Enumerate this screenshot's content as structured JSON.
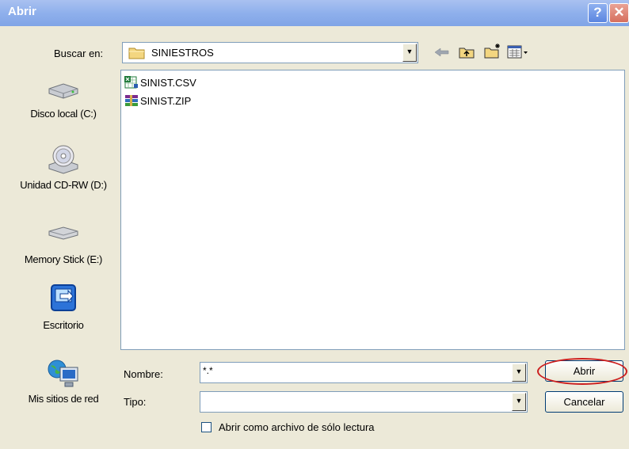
{
  "window": {
    "title": "Abrir"
  },
  "title_buttons": {
    "help": "?",
    "close": "✕"
  },
  "look_in": {
    "label": "Buscar en:",
    "value": "SINIESTROS",
    "icon": "folder-icon"
  },
  "toolbar": {
    "back_icon": "back-arrow-icon",
    "up_icon": "up-folder-icon",
    "new_folder_icon": "new-folder-icon",
    "view_icon": "view-menu-icon"
  },
  "places": [
    {
      "label": "Disco local (C:)",
      "icon": "hard-drive-icon"
    },
    {
      "label": "Unidad CD-RW (D:)",
      "icon": "cd-drive-icon"
    },
    {
      "label": "Memory Stick (E:)",
      "icon": "removable-drive-icon"
    },
    {
      "label": "Escritorio",
      "icon": "desktop-icon"
    },
    {
      "label": "Mis sitios de red",
      "icon": "network-places-icon"
    }
  ],
  "files": [
    {
      "name": "SINIST.CSV",
      "icon": "excel-file-icon"
    },
    {
      "name": "SINIST.ZIP",
      "icon": "winrar-file-icon"
    }
  ],
  "filename": {
    "label": "Nombre:",
    "value": "*.*"
  },
  "filetype": {
    "label": "Tipo:",
    "value": ""
  },
  "readonly": {
    "label": "Abrir como archivo de sólo lectura",
    "checked": false
  },
  "buttons": {
    "open": "Abrir",
    "cancel": "Cancelar"
  },
  "colors": {
    "titlebar": "#8fb0ec",
    "dialog": "#ece9d8",
    "highlight_ellipse": "#cc1f1f"
  }
}
